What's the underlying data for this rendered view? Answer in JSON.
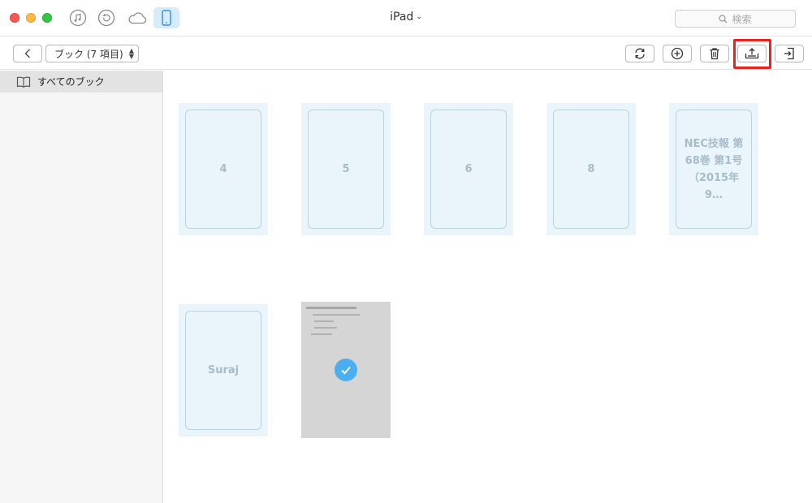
{
  "window": {
    "title": "iPad",
    "title_caret": "⌄"
  },
  "search": {
    "placeholder": "検索"
  },
  "toolbar": {
    "category_label": "ブック (7 項目)",
    "updown_glyph": "▲▼"
  },
  "sidebar": {
    "items": [
      {
        "label": "すべてのブック",
        "icon": "book-icon",
        "selected": true
      }
    ]
  },
  "books": [
    {
      "label": "4"
    },
    {
      "label": "5"
    },
    {
      "label": "6"
    },
    {
      "label": "8"
    },
    {
      "label": "NEC技報 第68巻 第1号（2015年9…"
    },
    {
      "label": "Suraj"
    },
    {
      "label": "",
      "selected": true,
      "thumbnail": "document-page"
    }
  ],
  "colors": {
    "accent": "#4aaeef",
    "highlight": "#e8231e",
    "book_bg": "#eaf5fb",
    "device_active_bg": "#d7ecfb"
  },
  "icons": {
    "titlebar": [
      "music-icon",
      "restore-icon",
      "cloud-icon",
      "device-icon"
    ],
    "tools": [
      "sync-icon",
      "add-icon",
      "delete-icon",
      "export-to-computer-icon",
      "import-to-device-icon"
    ]
  }
}
